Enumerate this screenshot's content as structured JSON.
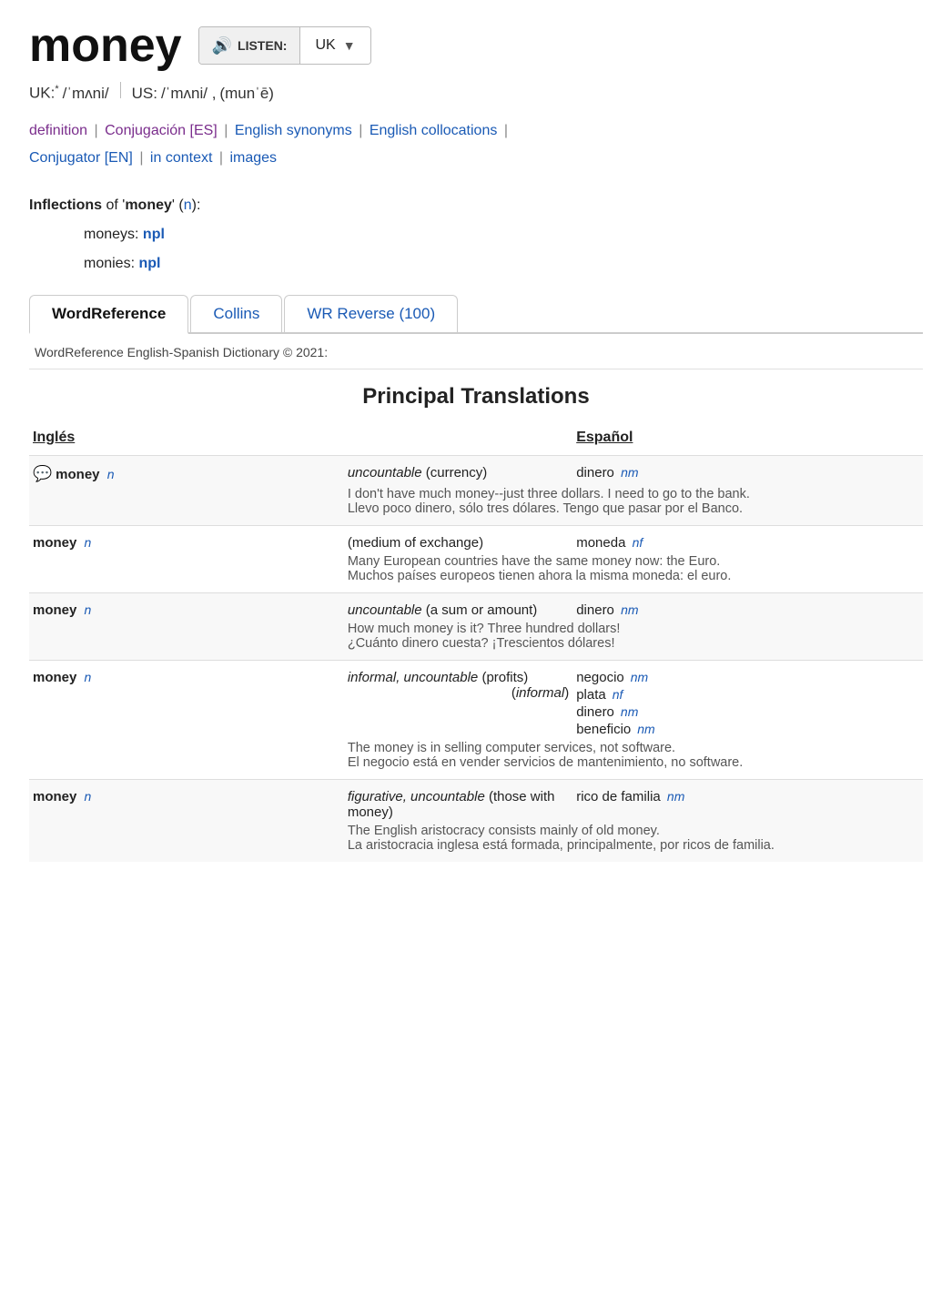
{
  "header": {
    "word": "money",
    "listen_label": "LISTEN:",
    "lang": "UK"
  },
  "pronunciation": {
    "uk_label": "UK:",
    "uk_star": "*",
    "uk_ipa": "/ˈmʌni/",
    "us_label": "US:",
    "us_ipa": "/ˈmʌni/ ,",
    "us_ipa2": "(munˈē)"
  },
  "nav": {
    "definition": "definition",
    "conjugacion": "Conjugación",
    "conjugacion_lang": "[ES]",
    "english_synonyms": "English synonyms",
    "english_collocations": "English collocations",
    "conjugator": "Conjugator",
    "conjugator_lang": "[EN]",
    "in_context": "in context",
    "images": "images"
  },
  "inflections": {
    "label": "Inflections",
    "word": "money",
    "pos": "n",
    "rows": [
      {
        "form": "moneys:",
        "tag": "npl"
      },
      {
        "form": "monies:",
        "tag": "npl"
      }
    ]
  },
  "tabs": [
    {
      "id": "wordreference",
      "label": "WordReference",
      "active": true
    },
    {
      "id": "collins",
      "label": "Collins",
      "active": false
    },
    {
      "id": "wr-reverse",
      "label": "WR Reverse (100)",
      "active": false
    }
  ],
  "copyright": "WordReference English-Spanish Dictionary © 2021:",
  "section_title": "Principal Translations",
  "table_headers": {
    "ingles": "Inglés",
    "espanol": "Español"
  },
  "entries": [
    {
      "id": 1,
      "has_chat": true,
      "bg_light": true,
      "word": "money",
      "pos": "n",
      "definition": "uncountable (currency)",
      "translation": "dinero",
      "trans_gender": "nm",
      "translations": null,
      "example_en": "I don't have much money--just three dollars. I need to go to the bank.",
      "example_es": "Llevo poco dinero, sólo tres dólares. Tengo que pasar por el Banco."
    },
    {
      "id": 2,
      "has_chat": false,
      "bg_light": false,
      "word": "money",
      "pos": "n",
      "definition": "(medium of exchange)",
      "translation": "moneda",
      "trans_gender": "nf",
      "translations": null,
      "example_en": "Many European countries have the same money now: the Euro.",
      "example_es": "Muchos países europeos tienen ahora la misma moneda: el euro."
    },
    {
      "id": 3,
      "has_chat": false,
      "bg_light": true,
      "word": "money",
      "pos": "n",
      "definition": "uncountable (a sum or amount)",
      "translation": "dinero",
      "trans_gender": "nm",
      "translations": null,
      "example_en": "How much money is it? Three hundred dollars!",
      "example_es": "¿Cuánto dinero cuesta? ¡Trescientos dólares!"
    },
    {
      "id": 4,
      "has_chat": false,
      "bg_light": false,
      "word": "money",
      "pos": "n",
      "definition": "informal, uncountable (profits)",
      "informal_note": "(informal)",
      "translations": [
        {
          "word": "negocio",
          "gender": "nm"
        },
        {
          "word": "plata",
          "gender": "nf"
        },
        {
          "word": "dinero",
          "gender": "nm"
        },
        {
          "word": "beneficio",
          "gender": "nm"
        }
      ],
      "translation": null,
      "trans_gender": null,
      "example_en": "The money is in selling computer services, not software.",
      "example_es": "El negocio está en vender servicios de mantenimiento, no software."
    },
    {
      "id": 5,
      "has_chat": false,
      "bg_light": true,
      "word": "money",
      "pos": "n",
      "definition": "figurative, uncountable (those with money)",
      "translation": "rico de familia",
      "trans_gender": "nm",
      "translations": null,
      "example_en": "The English aristocracy consists mainly of old money.",
      "example_es": "La aristocracia inglesa está formada, principalmente, por ricos de familia."
    }
  ]
}
